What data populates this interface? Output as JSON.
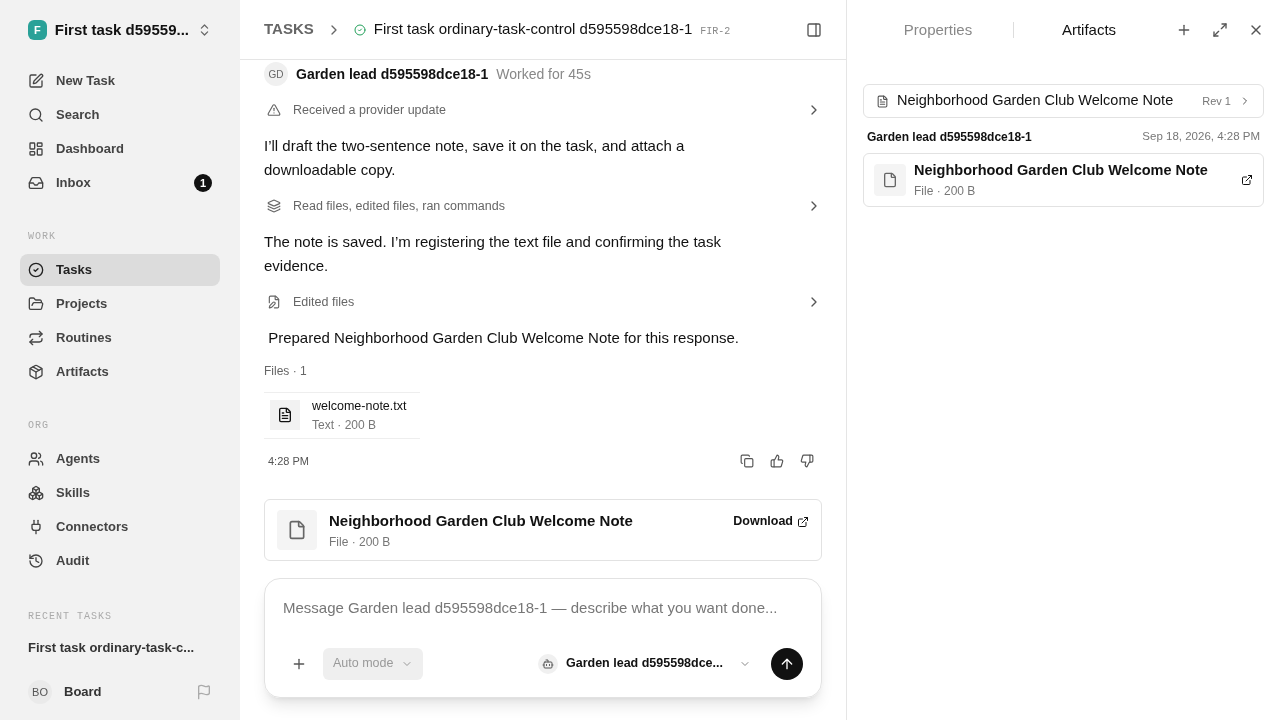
{
  "workspace": {
    "logo": "F",
    "name": "First task d59559..."
  },
  "nav": [
    {
      "label": "New Task",
      "selected": false
    },
    {
      "label": "Search",
      "selected": false
    },
    {
      "label": "Dashboard",
      "selected": false
    },
    {
      "label": "Inbox",
      "selected": false,
      "badge": "1"
    }
  ],
  "sections": [
    {
      "title": "WORK",
      "items": [
        {
          "label": "Tasks",
          "selected": true
        },
        {
          "label": "Projects",
          "selected": false
        },
        {
          "label": "Routines",
          "selected": false
        },
        {
          "label": "Artifacts",
          "selected": false
        }
      ]
    },
    {
      "title": "ORG",
      "items": [
        {
          "label": "Agents",
          "selected": false
        },
        {
          "label": "Skills",
          "selected": false
        },
        {
          "label": "Connectors",
          "selected": false
        },
        {
          "label": "Audit",
          "selected": false
        }
      ]
    }
  ],
  "recent": {
    "title": "RECENT TASKS",
    "items": [
      "First task ordinary-task-c..."
    ]
  },
  "user": {
    "initials": "BO",
    "name": "Board"
  },
  "breadcrumb": {
    "root": "TASKS",
    "title": "First task ordinary-task-control d595598dce18-1",
    "code": "FIR-2"
  },
  "message": {
    "avatar": "GD",
    "author": "Garden lead d595598dce18-1",
    "meta": "Worked for 45s"
  },
  "blocks": [
    {
      "kind": "notice",
      "text": "Received a provider update"
    },
    {
      "kind": "text",
      "text": "I’ll draft the two-sentence note, save it on the task, and attach a downloadable copy."
    },
    {
      "kind": "activity",
      "text": "Read files, edited files, ran commands"
    },
    {
      "kind": "text",
      "text": "The note is saved. I’m registering the text file and confirming the task evidence."
    },
    {
      "kind": "edit",
      "text": "Edited files"
    },
    {
      "kind": "text",
      "text": " Prepared Neighborhood Garden Club Welcome Note for this response."
    }
  ],
  "files": {
    "title": "Files · 1",
    "items": [
      {
        "name": "welcome-note.txt",
        "meta": "Text · 200 B"
      }
    ]
  },
  "time": "4:28 PM",
  "artifact_card": {
    "title": "Neighborhood Garden Club Welcome Note",
    "meta": "File · 200 B",
    "action": "Download"
  },
  "composer": {
    "placeholder": "Message Garden lead d595598dce18-1 — describe what you want done...",
    "mode": "Auto mode",
    "agent": "Garden lead d595598dce..."
  },
  "panel": {
    "tabs": [
      {
        "label": "Properties",
        "selected": false
      },
      {
        "label": "Artifacts",
        "selected": true
      }
    ],
    "artifact": {
      "title": "Neighborhood Garden Club Welcome Note",
      "rev": "Rev 1"
    },
    "author": "Garden lead d595598dce18-1",
    "date": "Sep 18, 2026, 4:28 PM",
    "file": {
      "title": "Neighborhood Garden Club Welcome Note",
      "meta": "File · 200 B"
    }
  }
}
